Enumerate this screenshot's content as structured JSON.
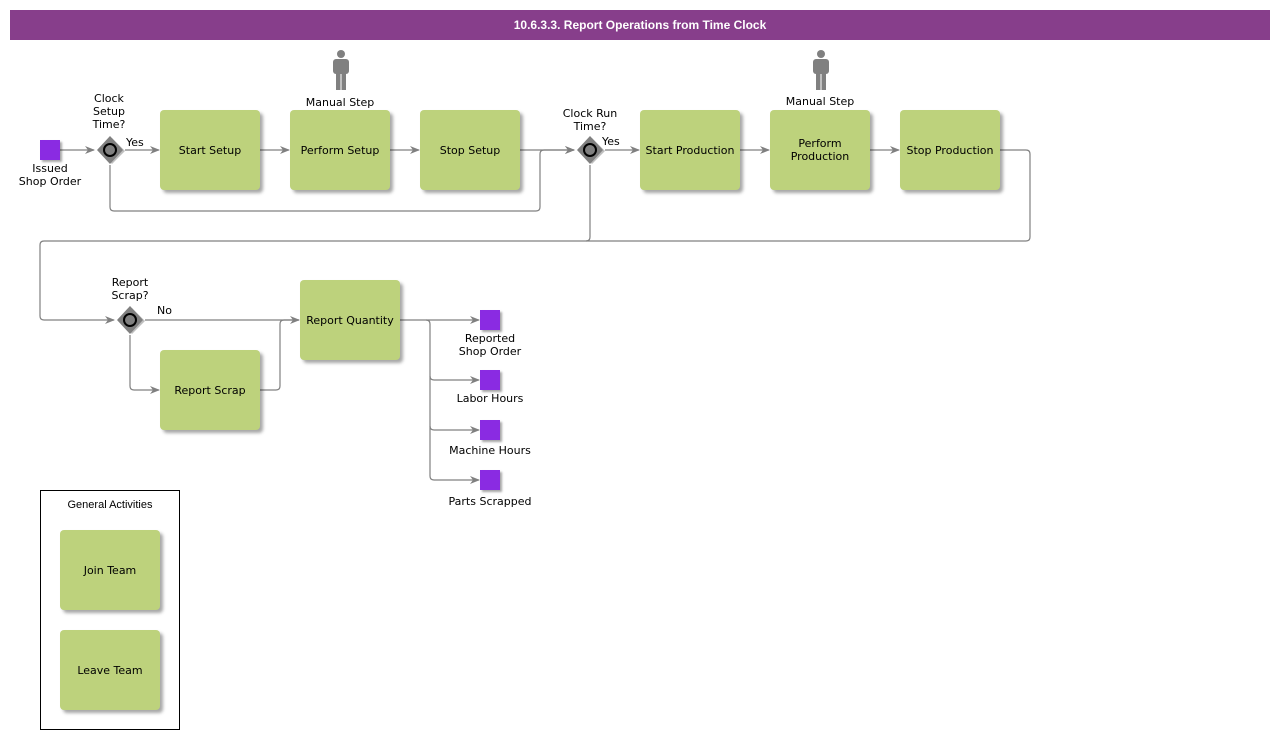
{
  "title": "10.6.3.3. Report Operations from Time Clock",
  "colors": {
    "header": "#873e8b",
    "task": "#bdd27c",
    "data_object": "#8a2be2",
    "gateway": "#808080",
    "connector": "#808080"
  },
  "events": {
    "issued_shop_order": "Issued\nShop Order",
    "reported_shop_order": "Reported\nShop Order",
    "labor_hours": "Labor Hours",
    "machine_hours": "Machine Hours",
    "parts_scrapped": "Parts Scrapped"
  },
  "gateways": {
    "clock_setup": {
      "label": "Clock\nSetup\nTime?",
      "yes_label": "Yes"
    },
    "clock_run": {
      "label": "Clock Run\nTime?",
      "yes_label": "Yes"
    },
    "report_scrap": {
      "label": "Report\nScrap?",
      "no_label": "No"
    }
  },
  "tasks": {
    "start_setup": "Start Setup",
    "perform_setup": "Perform Setup",
    "stop_setup": "Stop Setup",
    "start_production": "Start Production",
    "perform_production": "Perform\nProduction",
    "stop_production": "Stop Production",
    "report_quantity": "Report Quantity",
    "report_scrap": "Report Scrap"
  },
  "actors": {
    "perform_setup": "Manual Step",
    "perform_production": "Manual Step"
  },
  "group": {
    "title": "General Activities",
    "tasks": [
      "Join Team",
      "Leave Team"
    ]
  }
}
